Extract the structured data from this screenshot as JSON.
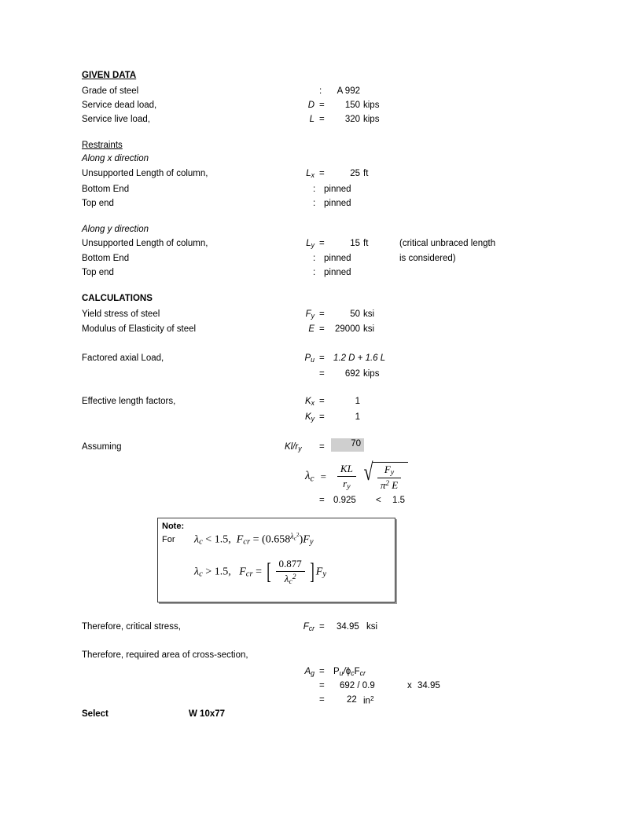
{
  "document": {
    "type": "steel-column-design-calculation-sheet"
  },
  "given_data": {
    "heading": "GIVEN DATA",
    "rows": [
      {
        "label": "Grade of steel",
        "symbol": "",
        "op": ":",
        "value": "A 992",
        "unit": ""
      },
      {
        "label": "Service dead load,",
        "symbol": "D",
        "op": "=",
        "value": "150",
        "unit": "kips"
      },
      {
        "label": "Service live load,",
        "symbol": "L",
        "op": "=",
        "value": "320",
        "unit": "kips"
      }
    ]
  },
  "restraints": {
    "heading": "Restraints",
    "x_direction": {
      "subheading": "Along x direction",
      "length_label": "Unsupported Length of column,",
      "length_symbol": "L",
      "length_subscript": "x",
      "length_op": "=",
      "length_value": "25",
      "length_unit": "ft",
      "bottom_label": "Bottom End",
      "bottom_op": ":",
      "bottom_value": "pinned",
      "top_label": "Top end",
      "top_op": ":",
      "top_value": "pinned"
    },
    "y_direction": {
      "subheading": "Along y direction",
      "length_label": "Unsupported Length of column,",
      "length_symbol": "L",
      "length_subscript": "y",
      "length_op": "=",
      "length_value": "15",
      "length_unit": "ft",
      "note_line_1": "(critical unbraced length",
      "note_line_2": "is considered)",
      "bottom_label": "Bottom End",
      "bottom_op": ":",
      "bottom_value": "pinned",
      "top_label": "Top end",
      "top_op": ":",
      "top_value": "pinned"
    }
  },
  "calculations": {
    "heading": "CALCULATIONS",
    "yield_stress": {
      "label": "Yield stress of steel",
      "symbol": "F",
      "subscript": "y",
      "op": "=",
      "value": "50",
      "unit": "ksi"
    },
    "modulus": {
      "label": "Modulus of Elasticity of steel",
      "symbol": "E",
      "subscript": "",
      "op": "=",
      "value": "29000",
      "unit": "ksi"
    },
    "factored_load": {
      "label": "Factored axial Load,",
      "symbol": "P",
      "subscript": "u",
      "op": "=",
      "formula": "1.2 D + 1.6 L",
      "result_op": "=",
      "result_value": "692",
      "result_unit": "kips"
    },
    "effective_length": {
      "label": "Effective length factors,",
      "kx_symbol": "K",
      "kx_subscript": "x",
      "kx_op": "=",
      "kx_value": "1",
      "ky_symbol": "K",
      "ky_subscript": "y",
      "ky_op": "=",
      "ky_value": "1"
    },
    "assuming": {
      "label": "Assuming",
      "symbol": "Kl/r",
      "subscript": "y",
      "op": "=",
      "value": "70",
      "highlight_color": "#cfcfcf"
    },
    "lambda": {
      "symbol": "λ",
      "subscript": "c",
      "op": "=",
      "frac_num": "KL",
      "frac_den": "r",
      "frac_den_sub": "y",
      "rad_num": "F",
      "rad_num_sub": "y",
      "rad_den_pi": "π",
      "rad_den_exp": "2",
      "rad_den_E": "E",
      "result_op": "=",
      "result_value": "0.925",
      "comparison_op": "<",
      "comparison_value": "1.5"
    },
    "note_box": {
      "title": "Note:",
      "for_label": "For",
      "eq1": {
        "lambda": "λ",
        "lambda_sub": "c",
        "rel": "< 1.5,",
        "fcr": "F",
        "fcr_sub": "cr",
        "eq": "=",
        "expr_open": "(0.658",
        "exp_lambda": "λ",
        "exp_lambda_sub": "c",
        "exp_power": "2",
        "expr_close": ")",
        "fy": "F",
        "fy_sub": "y"
      },
      "eq2": {
        "lambda": "λ",
        "lambda_sub": "c",
        "rel": "> 1.5,",
        "fcr": "F",
        "fcr_sub": "cr",
        "eq": "=",
        "num": "0.877",
        "den_lambda": "λ",
        "den_lambda_sub": "c",
        "den_power": "2",
        "fy": "F",
        "fy_sub": "y"
      }
    },
    "critical_stress": {
      "label": "Therefore, critical stress,",
      "symbol": "F",
      "subscript": "cr",
      "op": "=",
      "value": "34.95",
      "unit": "ksi"
    },
    "required_area": {
      "label": "Therefore, required area of cross-section,",
      "symbol": "A",
      "subscript": "g",
      "op": "=",
      "formula_pu": "P",
      "formula_pu_sub": "u",
      "formula_slash": "/",
      "formula_phi": "ϕ",
      "formula_phi_sub": "c",
      "formula_fcr": "F",
      "formula_fcr_sub": "cr",
      "line2_op": "=",
      "line2_value": "692 / 0.9",
      "line2_mult": "x",
      "line2_factor": "34.95",
      "line3_op": "=",
      "line3_value": "22",
      "line3_unit": "in",
      "line3_unit_sup": "2"
    },
    "select": {
      "label": "Select",
      "value": "W 10x77"
    }
  }
}
